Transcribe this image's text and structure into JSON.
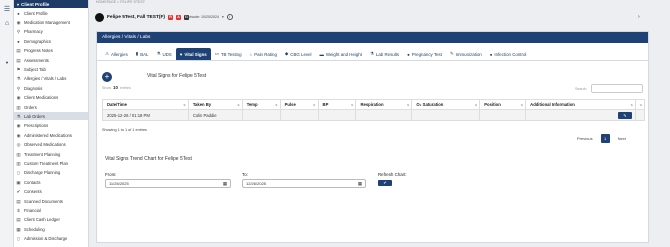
{
  "breadcrumb": "HOMEPAGE > FELIPE STEST",
  "patient": {
    "name": "Felipe 5Test, Fall TEST(F)",
    "badges": [
      "R",
      "A",
      "B"
    ],
    "episode_label": "Episode: 10/20/2024",
    "episode_info": "i"
  },
  "sidebar": {
    "header": "Client Profile",
    "items": [
      {
        "label": "Client Profile",
        "icon": "person-icon"
      },
      {
        "label": "Medication Management",
        "icon": "pill-icon"
      },
      {
        "label": "Pharmacy",
        "icon": "search-icon"
      },
      {
        "label": "Demographics",
        "icon": "person-icon"
      },
      {
        "label": "Progress Notes",
        "icon": "document-icon"
      },
      {
        "label": "Assessments",
        "icon": "document-icon"
      },
      {
        "label": "Subject Tab",
        "icon": "flag-icon"
      },
      {
        "label": "Allergies / Vitals / Labs",
        "icon": "flask-icon"
      },
      {
        "label": "Diagnosis",
        "icon": "search-icon"
      },
      {
        "label": "Client Medications",
        "icon": "pill-icon"
      },
      {
        "label": "Orders",
        "icon": "clipboard-icon"
      },
      {
        "label": "Lab Orders",
        "icon": "flask-icon"
      },
      {
        "label": "Prescriptions",
        "icon": "pill-icon"
      },
      {
        "label": "Administered Medications",
        "icon": "pill-icon"
      },
      {
        "label": "Observed Medications",
        "icon": "eye-icon"
      },
      {
        "label": "Treatment Planning",
        "icon": "clipboard-icon"
      },
      {
        "label": "Custom Treatment Plan",
        "icon": "clipboard-icon"
      },
      {
        "label": "Discharge Planning",
        "icon": "door-icon"
      },
      {
        "label": "Contacts",
        "icon": "contact-icon"
      },
      {
        "label": "Consents",
        "icon": "check-icon"
      },
      {
        "label": "Scanned Documents",
        "icon": "document-icon"
      },
      {
        "label": "Financial",
        "icon": "dollar-icon"
      },
      {
        "label": "Client Cash Ledger",
        "icon": "document-icon"
      },
      {
        "label": "Scheduling",
        "icon": "calendar-icon"
      },
      {
        "label": "Admission & Discharge",
        "icon": "door-icon"
      }
    ]
  },
  "panel": {
    "header": "Allergies / Vitals / Labs",
    "tabs": [
      {
        "label": "Allergies",
        "icon": "warning-icon"
      },
      {
        "label": "BAL",
        "icon": "chart-icon"
      },
      {
        "label": "UDS",
        "icon": "flask-icon"
      },
      {
        "label": "Vital Signs",
        "icon": "heart-icon"
      },
      {
        "label": "TB Testing",
        "icon": "car-icon"
      },
      {
        "label": "Pain Rating",
        "icon": "circle-icon"
      },
      {
        "label": "CBG Level",
        "icon": "drop-icon"
      },
      {
        "label": "Weight and Height",
        "icon": "scale-icon"
      },
      {
        "label": "Lab Results",
        "icon": "flask-icon"
      },
      {
        "label": "Pregnancy Test",
        "icon": "person-icon"
      },
      {
        "label": "Immunization",
        "icon": "syringe-icon"
      },
      {
        "label": "Infection Control",
        "icon": "person-icon"
      }
    ],
    "section_title": "Vital Signs for Felipe 5Test",
    "show_label": "Show",
    "entries_count": "10",
    "entries_label": "entries",
    "search_label": "Search:",
    "columns": [
      "Date/Time",
      "Taken By",
      "Temp",
      "Pulse",
      "BP",
      "Respiration",
      "O₂ Saturation",
      "Position",
      "Additional Information",
      ""
    ],
    "rows": [
      [
        "2025-12-26 / 01:18 PM",
        "Colin Paddie",
        "",
        "",
        "",
        "",
        "",
        "",
        "",
        ""
      ]
    ],
    "showing_text": "Showing 1 to 1 of 1 entries",
    "pager": {
      "previous": "Previous",
      "current": "1",
      "next": "Next"
    },
    "trend_title": "Vital Signs Trend Chart for Felipe 5Test",
    "from_label": "From:",
    "from_value": "11/26/2025",
    "to_label": "To:",
    "to_value": "12/26/2025",
    "refresh_label": "Refresh Chart:"
  }
}
